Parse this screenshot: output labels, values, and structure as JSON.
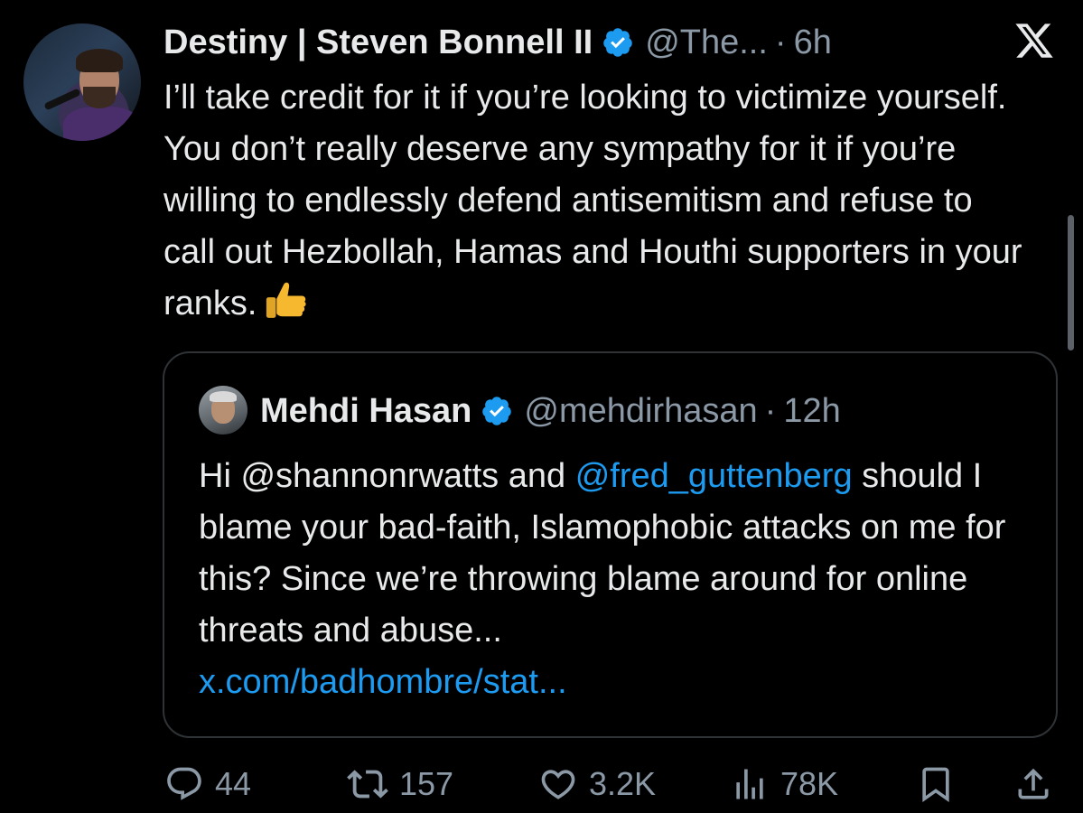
{
  "tweet": {
    "author_name": "Destiny | Steven Bonnell II",
    "handle": "@The...",
    "separator": "·",
    "time": "6h",
    "text": "I’ll take credit for it if you’re looking to victimize yourself. You don’t really deserve any sympathy for it if you’re willing to endlessly defend antisemitism and refuse to call out Hezbollah, Hamas and Houthi supporters in your ranks.",
    "emoji": "thumbs-up-icon"
  },
  "quoted_tweet": {
    "author_name": "Mehdi Hasan",
    "handle": "@mehdirhasan",
    "separator": "·",
    "time": "12h",
    "text_prefix": "Hi @shannonrwatts and ",
    "mention": "@fred_guttenberg",
    "text_rest": " should I blame your bad-faith, Islamophobic attacks on me for this? Since we’re throwing blame around for online threats and abuse...",
    "link": "x.com/badhombre/stat..."
  },
  "actions": {
    "replies": "44",
    "retweets": "157",
    "likes": "3.2K",
    "views": "78K"
  },
  "colors": {
    "background": "#000000",
    "text": "#e7e9ea",
    "secondary_text": "#8b98a5",
    "link": "#1d9bf0",
    "verified_badge": "#1d9bf0",
    "border": "#2f3336"
  }
}
